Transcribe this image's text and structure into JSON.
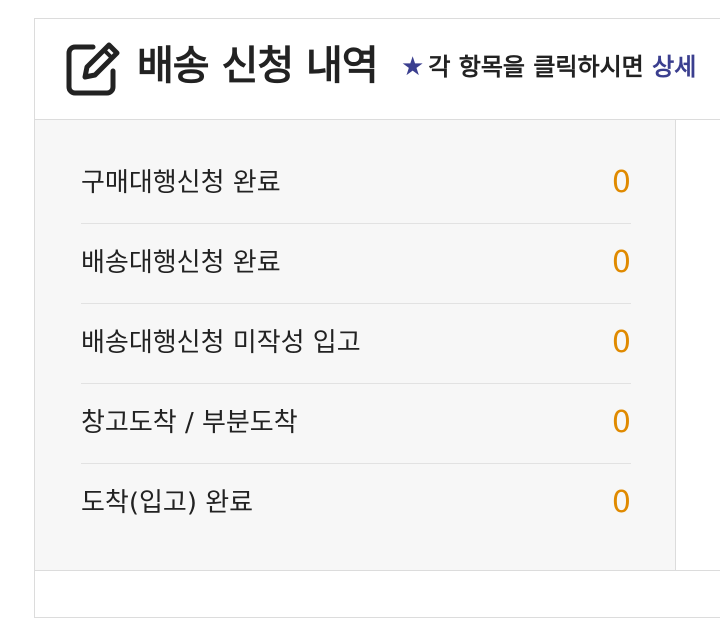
{
  "header": {
    "icon": "edit-square-icon",
    "title": "배송 신청 내역",
    "hint_icon": "star-icon",
    "hint_text": "각 항목을 클릭하시면",
    "hint_link": "상세"
  },
  "colors": {
    "accent": "#3b3f8f",
    "count": "#e08a00",
    "panel_bg": "#f7f7f7",
    "border": "#dcdcdc"
  },
  "status_items": [
    {
      "label": "구매대행신청 완료",
      "count": "0"
    },
    {
      "label": "배송대행신청 완료",
      "count": "0"
    },
    {
      "label": "배송대행신청 미작성 입고",
      "count": "0"
    },
    {
      "label": "창고도착 / 부분도착",
      "count": "0"
    },
    {
      "label": "도착(입고) 완료",
      "count": "0"
    }
  ]
}
